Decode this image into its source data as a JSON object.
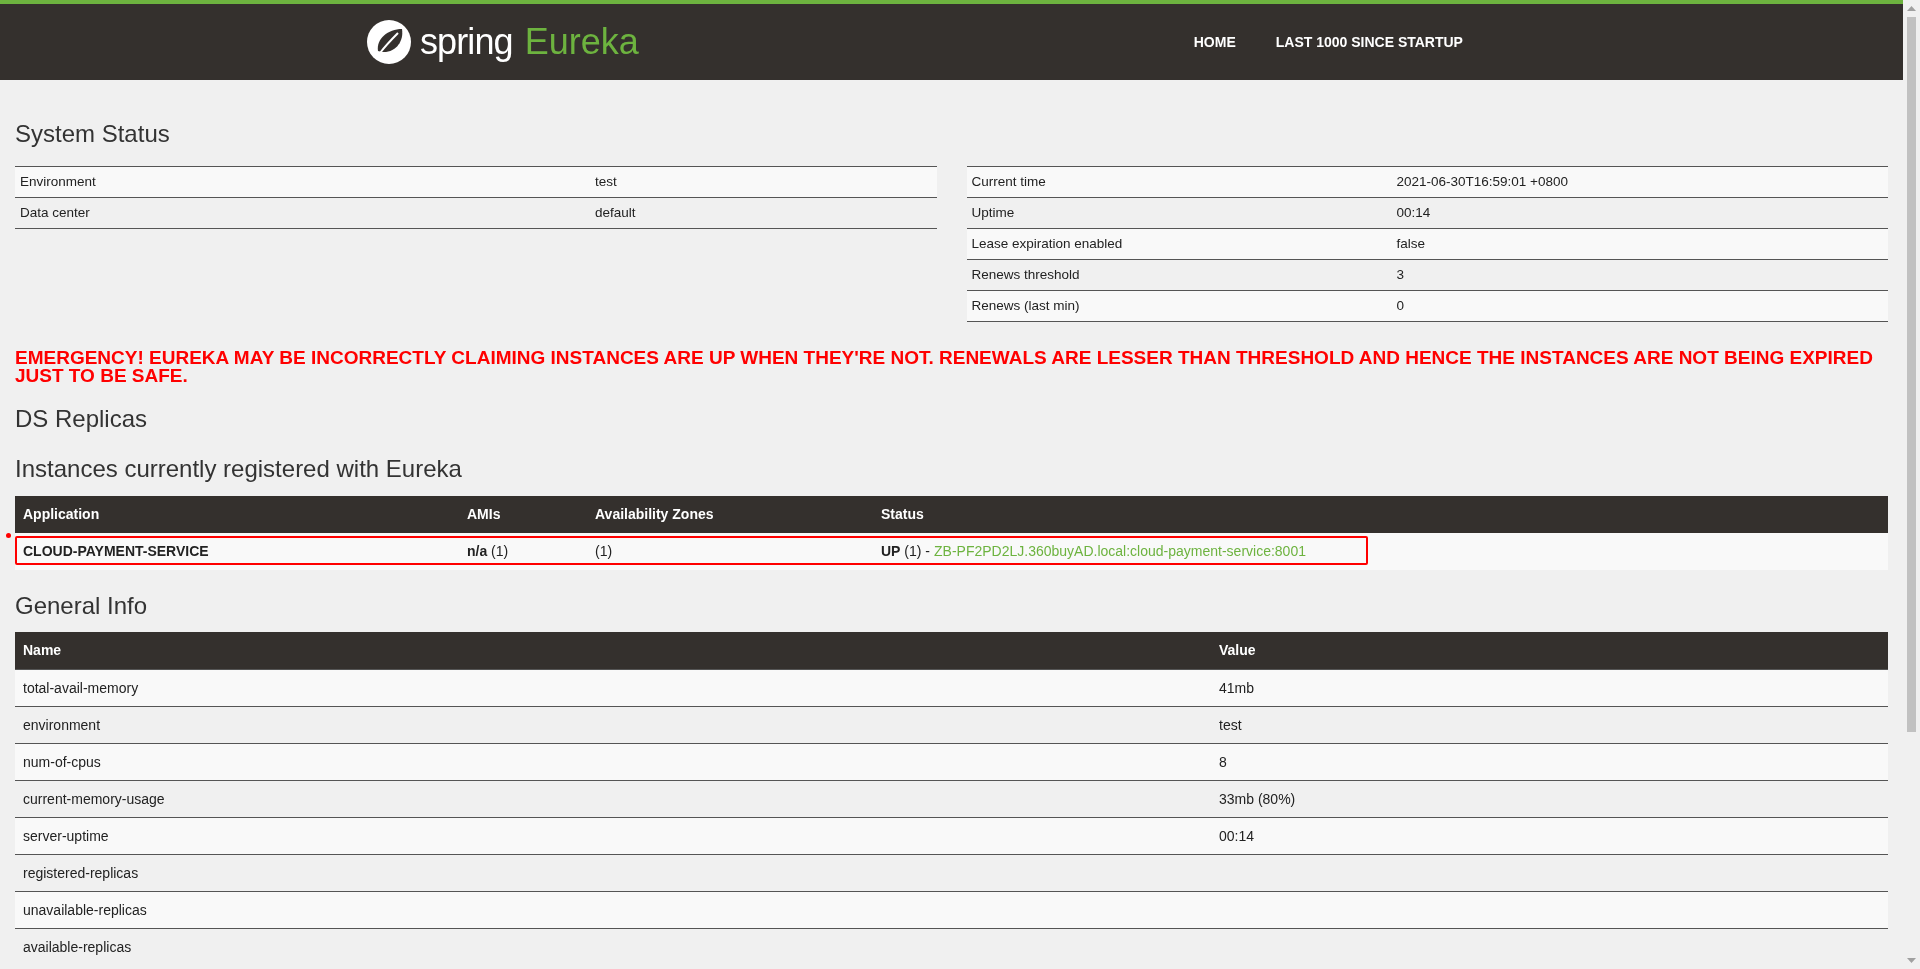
{
  "header": {
    "logo": {
      "word_1": "spring",
      "word_2": "Eureka"
    },
    "nav": [
      {
        "label": "HOME"
      },
      {
        "label": "LAST 1000 SINCE STARTUP"
      }
    ]
  },
  "system_status": {
    "title": "System Status",
    "left_rows": [
      {
        "label": "Environment",
        "value": "test"
      },
      {
        "label": "Data center",
        "value": "default"
      }
    ],
    "right_rows": [
      {
        "label": "Current time",
        "value": "2021-06-30T16:59:01 +0800"
      },
      {
        "label": "Uptime",
        "value": "00:14"
      },
      {
        "label": "Lease expiration enabled",
        "value": "false"
      },
      {
        "label": "Renews threshold",
        "value": "3"
      },
      {
        "label": "Renews (last min)",
        "value": "0"
      }
    ]
  },
  "alert": "EMERGENCY! EUREKA MAY BE INCORRECTLY CLAIMING INSTANCES ARE UP WHEN THEY'RE NOT. RENEWALS ARE LESSER THAN THRESHOLD AND HENCE THE INSTANCES ARE NOT BEING EXPIRED JUST TO BE SAFE.",
  "ds_replicas": {
    "title": "DS Replicas"
  },
  "instances": {
    "title": "Instances currently registered with Eureka",
    "columns": [
      "Application",
      "AMIs",
      "Availability Zones",
      "Status"
    ],
    "rows": [
      {
        "application": "CLOUD-PAYMENT-SERVICE",
        "amis": "**n/a** (1)",
        "zones": "(1)",
        "status": "**UP** (1) -",
        "instance_link": "ZB-PF2PD2LJ.360buyAD.local:cloud-payment-service:8001",
        "highlighted": true
      }
    ]
  },
  "general_info": {
    "title": "General Info",
    "columns": [
      "Name",
      "Value"
    ],
    "rows": [
      {
        "name": "total-avail-memory",
        "value": "41mb"
      },
      {
        "name": "environment",
        "value": "test"
      },
      {
        "name": "num-of-cpus",
        "value": "8"
      },
      {
        "name": "current-memory-usage",
        "value": "33mb (80%)"
      },
      {
        "name": "server-uptime",
        "value": "00:14"
      },
      {
        "name": "registered-replicas"
      },
      {
        "name": "unavailable-replicas"
      },
      {
        "name": "available-replicas"
      }
    ]
  }
}
